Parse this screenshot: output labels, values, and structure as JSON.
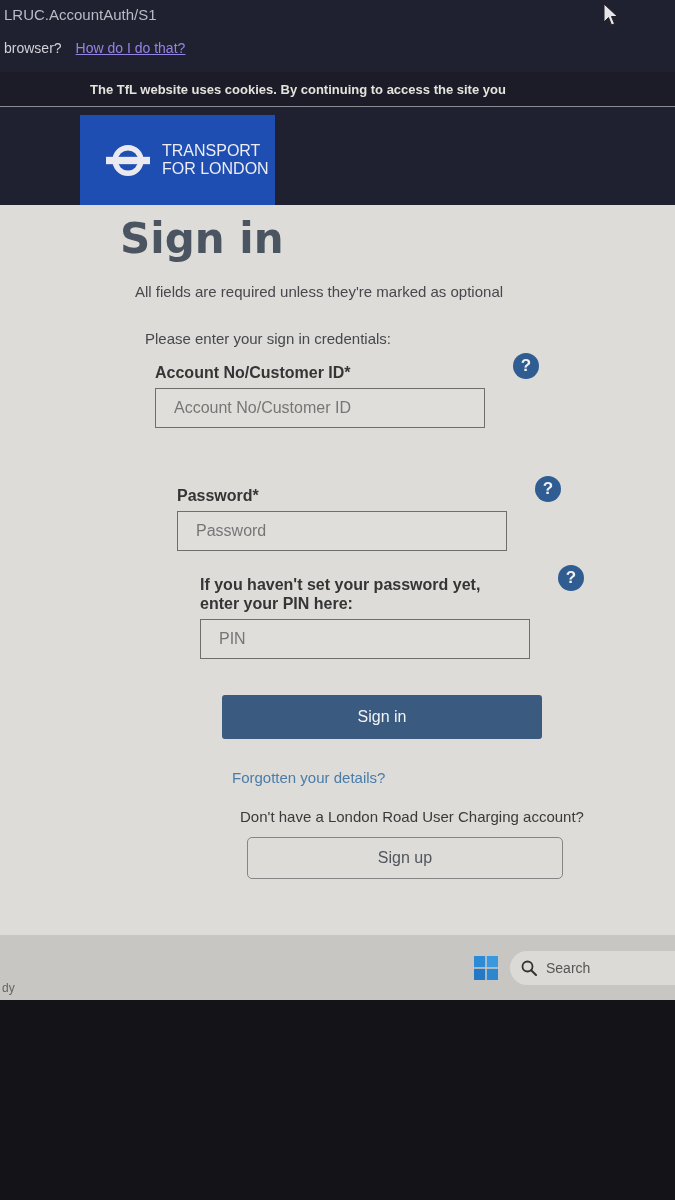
{
  "browser": {
    "address": "LRUC.AccountAuth/S1"
  },
  "notice": {
    "text": "browser?",
    "link": "How do I do that?"
  },
  "cookie_banner": {
    "text": "The TfL website uses cookies. By continuing to access the site you"
  },
  "logo": {
    "text": "TRANSPORT FOR LONDON"
  },
  "page": {
    "title": "Sign in",
    "intro": "All fields are required unless they're marked as optional",
    "prompt": "Please enter your sign in credentials:"
  },
  "fields": [
    {
      "label": "Account No/Customer ID*",
      "placeholder": "Account No/Customer ID",
      "help": "?"
    },
    {
      "label": "Password*",
      "placeholder": "Password",
      "help": "?"
    },
    {
      "label": "If you haven't set your password yet, enter your PIN here:",
      "placeholder": "PIN",
      "help": "?"
    }
  ],
  "sign_in_button": "Sign in",
  "forgot_link": "Forgotten your details?",
  "signup_prompt": "Don't have a London Road User Charging account?",
  "sign_up_button": "Sign up",
  "taskbar": {
    "status": "dy",
    "search": {
      "placeholder": "Search"
    }
  }
}
